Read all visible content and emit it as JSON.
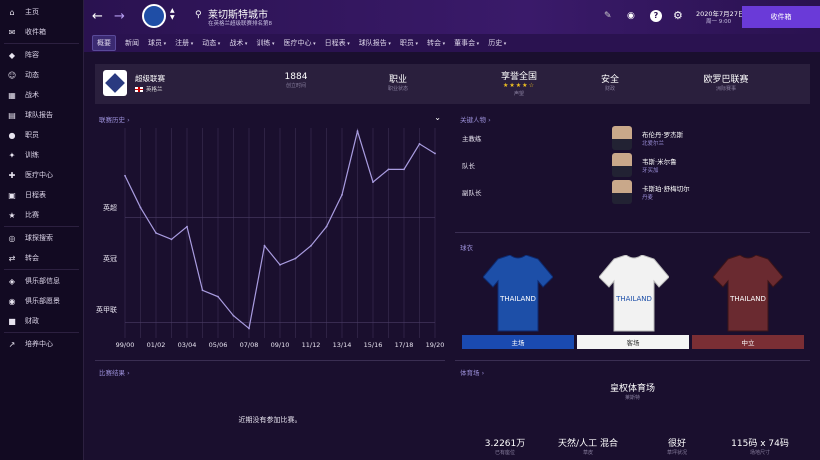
{
  "sidebar": {
    "items": [
      {
        "label": "主页",
        "icon": "home-icon"
      },
      {
        "label": "收件箱",
        "icon": "inbox-icon"
      },
      {
        "label": "阵容",
        "icon": "shirt-icon"
      },
      {
        "label": "动态",
        "icon": "dynamics-icon"
      },
      {
        "label": "战术",
        "icon": "tactics-icon"
      },
      {
        "label": "球队报告",
        "icon": "report-icon"
      },
      {
        "label": "职员",
        "icon": "staff-icon"
      },
      {
        "label": "训练",
        "icon": "training-icon"
      },
      {
        "label": "医疗中心",
        "icon": "medical-icon"
      },
      {
        "label": "日程表",
        "icon": "calendar-icon"
      },
      {
        "label": "比赛",
        "icon": "trophy-icon"
      },
      {
        "label": "球探搜索",
        "icon": "scout-icon"
      },
      {
        "label": "转会",
        "icon": "transfer-icon"
      },
      {
        "label": "俱乐部信息",
        "icon": "shield-icon"
      },
      {
        "label": "俱乐部愿景",
        "icon": "vision-icon"
      },
      {
        "label": "财政",
        "icon": "finance-icon"
      },
      {
        "label": "培养中心",
        "icon": "development-icon"
      }
    ]
  },
  "topbar": {
    "club_name": "莱切斯特城市",
    "subtitle": "在英格兰超级联赛排名第8",
    "date": "2020年7月27日",
    "time": "周一 9:00",
    "inbox_label": "收件箱",
    "help_label": "?"
  },
  "nav": {
    "items": [
      "概要",
      "新闻",
      "球员",
      "注册",
      "动态",
      "战术",
      "训练",
      "医疗中心",
      "日程表",
      "球队报告",
      "职员",
      "转会",
      "董事会",
      "历史"
    ]
  },
  "info": {
    "league_name": "超级联赛",
    "country": "英格兰",
    "founded_value": "1884",
    "founded_label": "创立时间",
    "status_value": "职业",
    "status_label": "职业状态",
    "reputation_value": "享誉全国",
    "reputation_label": "声望",
    "reputation_stars": 4,
    "finance_value": "安全",
    "finance_label": "财政",
    "euro_value": "欧罗巴联赛",
    "euro_label": "洲际赛事"
  },
  "league_history": {
    "title": "联赛历史",
    "dropdown_icon": "chevron-down-icon"
  },
  "chart_data": {
    "type": "line",
    "categories": [
      "99/00",
      "00/01",
      "01/02",
      "02/03",
      "03/04",
      "04/05",
      "05/06",
      "06/07",
      "07/08",
      "08/09",
      "09/10",
      "10/11",
      "11/12",
      "12/13",
      "13/14",
      "14/15",
      "15/16",
      "16/17",
      "17/18",
      "18/19",
      "19/20"
    ],
    "x_tick_labels": [
      "99/00",
      "01/02",
      "03/04",
      "05/06",
      "07/08",
      "09/10",
      "11/12",
      "13/14",
      "15/16",
      "17/18",
      "19/20"
    ],
    "values": [
      8,
      13,
      17,
      18,
      16,
      26,
      27,
      30,
      32,
      19,
      22,
      21,
      19,
      16,
      11,
      1,
      9,
      7,
      7,
      3,
      null
    ],
    "y_labels": [
      "英超",
      "英冠",
      "英甲联"
    ],
    "y_inverted": true,
    "grid": true
  },
  "key_people": {
    "title": "关键人物",
    "rows": [
      {
        "role": "主教练",
        "name": "布伦丹·罗杰斯",
        "nationality": "北爱尔兰"
      },
      {
        "role": "队长",
        "name": "韦斯·米尔鲁",
        "nationality": "牙买加"
      },
      {
        "role": "副队长",
        "name": "卡斯珀·舒梅切尔",
        "nationality": "丹麦"
      }
    ]
  },
  "kits": {
    "title": "球衣",
    "home_label": "主场",
    "away_label": "客场",
    "third_label": "中立",
    "sponsor": "THAILAND",
    "colors": {
      "home": "#1d4fa8",
      "away": "#f2f2f2",
      "third": "#6a2a30"
    }
  },
  "results": {
    "title": "比赛结果",
    "empty_text": "近期没有参加比赛。"
  },
  "stadium": {
    "title": "体育场",
    "name": "皇权体育场",
    "owner_label": "莱斯特",
    "capacity": "3.2261万",
    "capacity_label": "已有座位",
    "surface": "天然/人工 混合",
    "surface_label": "草皮",
    "condition": "很好",
    "condition_label": "草坪状况",
    "dimensions": "115码 x 74码",
    "dimensions_label": "场地尺寸"
  },
  "colors": {
    "accent": "#6a3ad8",
    "chart_line": "#a99ce0",
    "home_btn": "#1a4ab0",
    "away_btn": "#f4f4f4",
    "third_btn": "#7a2e34"
  }
}
